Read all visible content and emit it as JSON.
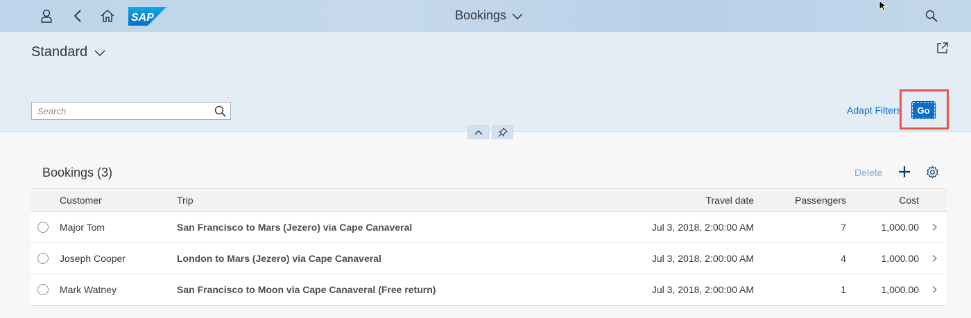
{
  "shell": {
    "title": "Bookings",
    "logo_text": "SAP"
  },
  "header": {
    "variant": "Standard",
    "search_placeholder": "Search",
    "adapt_filters": "Adapt Filters",
    "go": "Go"
  },
  "table": {
    "title": "Bookings (3)",
    "delete": "Delete",
    "columns": [
      "Customer",
      "Trip",
      "Travel date",
      "Passengers",
      "Cost"
    ],
    "rows": [
      {
        "customer": "Major Tom",
        "trip": "San Francisco to Mars (Jezero) via Cape Canaveral",
        "date": "Jul 3, 2018, 2:00:00 AM",
        "passengers": "7",
        "cost": "1,000.00"
      },
      {
        "customer": "Joseph Cooper",
        "trip": "London to Mars (Jezero) via Cape Canaveral",
        "date": "Jul 3, 2018, 2:00:00 AM",
        "passengers": "4",
        "cost": "1,000.00"
      },
      {
        "customer": "Mark Watney",
        "trip": "San Francisco to Moon via Cape Canaveral (Free return)",
        "date": "Jul 3, 2018, 2:00:00 AM",
        "passengers": "1",
        "cost": "1,000.00"
      }
    ]
  },
  "icons": {
    "user": "user-icon",
    "back": "back-icon",
    "home": "home-icon",
    "search": "search-icon",
    "share": "share-icon",
    "collapse": "chevron-up-icon",
    "pin": "pin-icon",
    "add": "add-icon",
    "settings": "gear-icon"
  },
  "colors": {
    "accent": "#0a6ed1",
    "highlight": "#e9554b"
  }
}
